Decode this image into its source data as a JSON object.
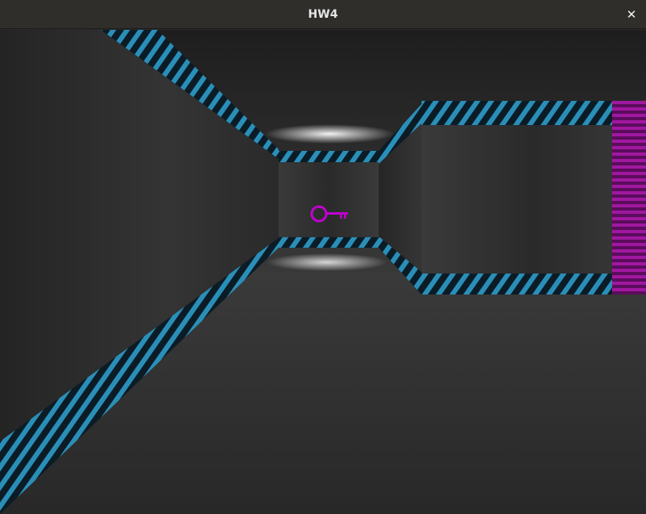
{
  "window": {
    "title": "HW4",
    "close_glyph": "✕"
  },
  "scene": {
    "pickup_icon": "key-icon",
    "colors": {
      "wall": "#2d2d2d",
      "floor": "#2c2c2c",
      "ceiling": "#262626",
      "stripe_accent": "#2a8fb8",
      "key": "#c000d0",
      "door": "#a0189f"
    }
  }
}
